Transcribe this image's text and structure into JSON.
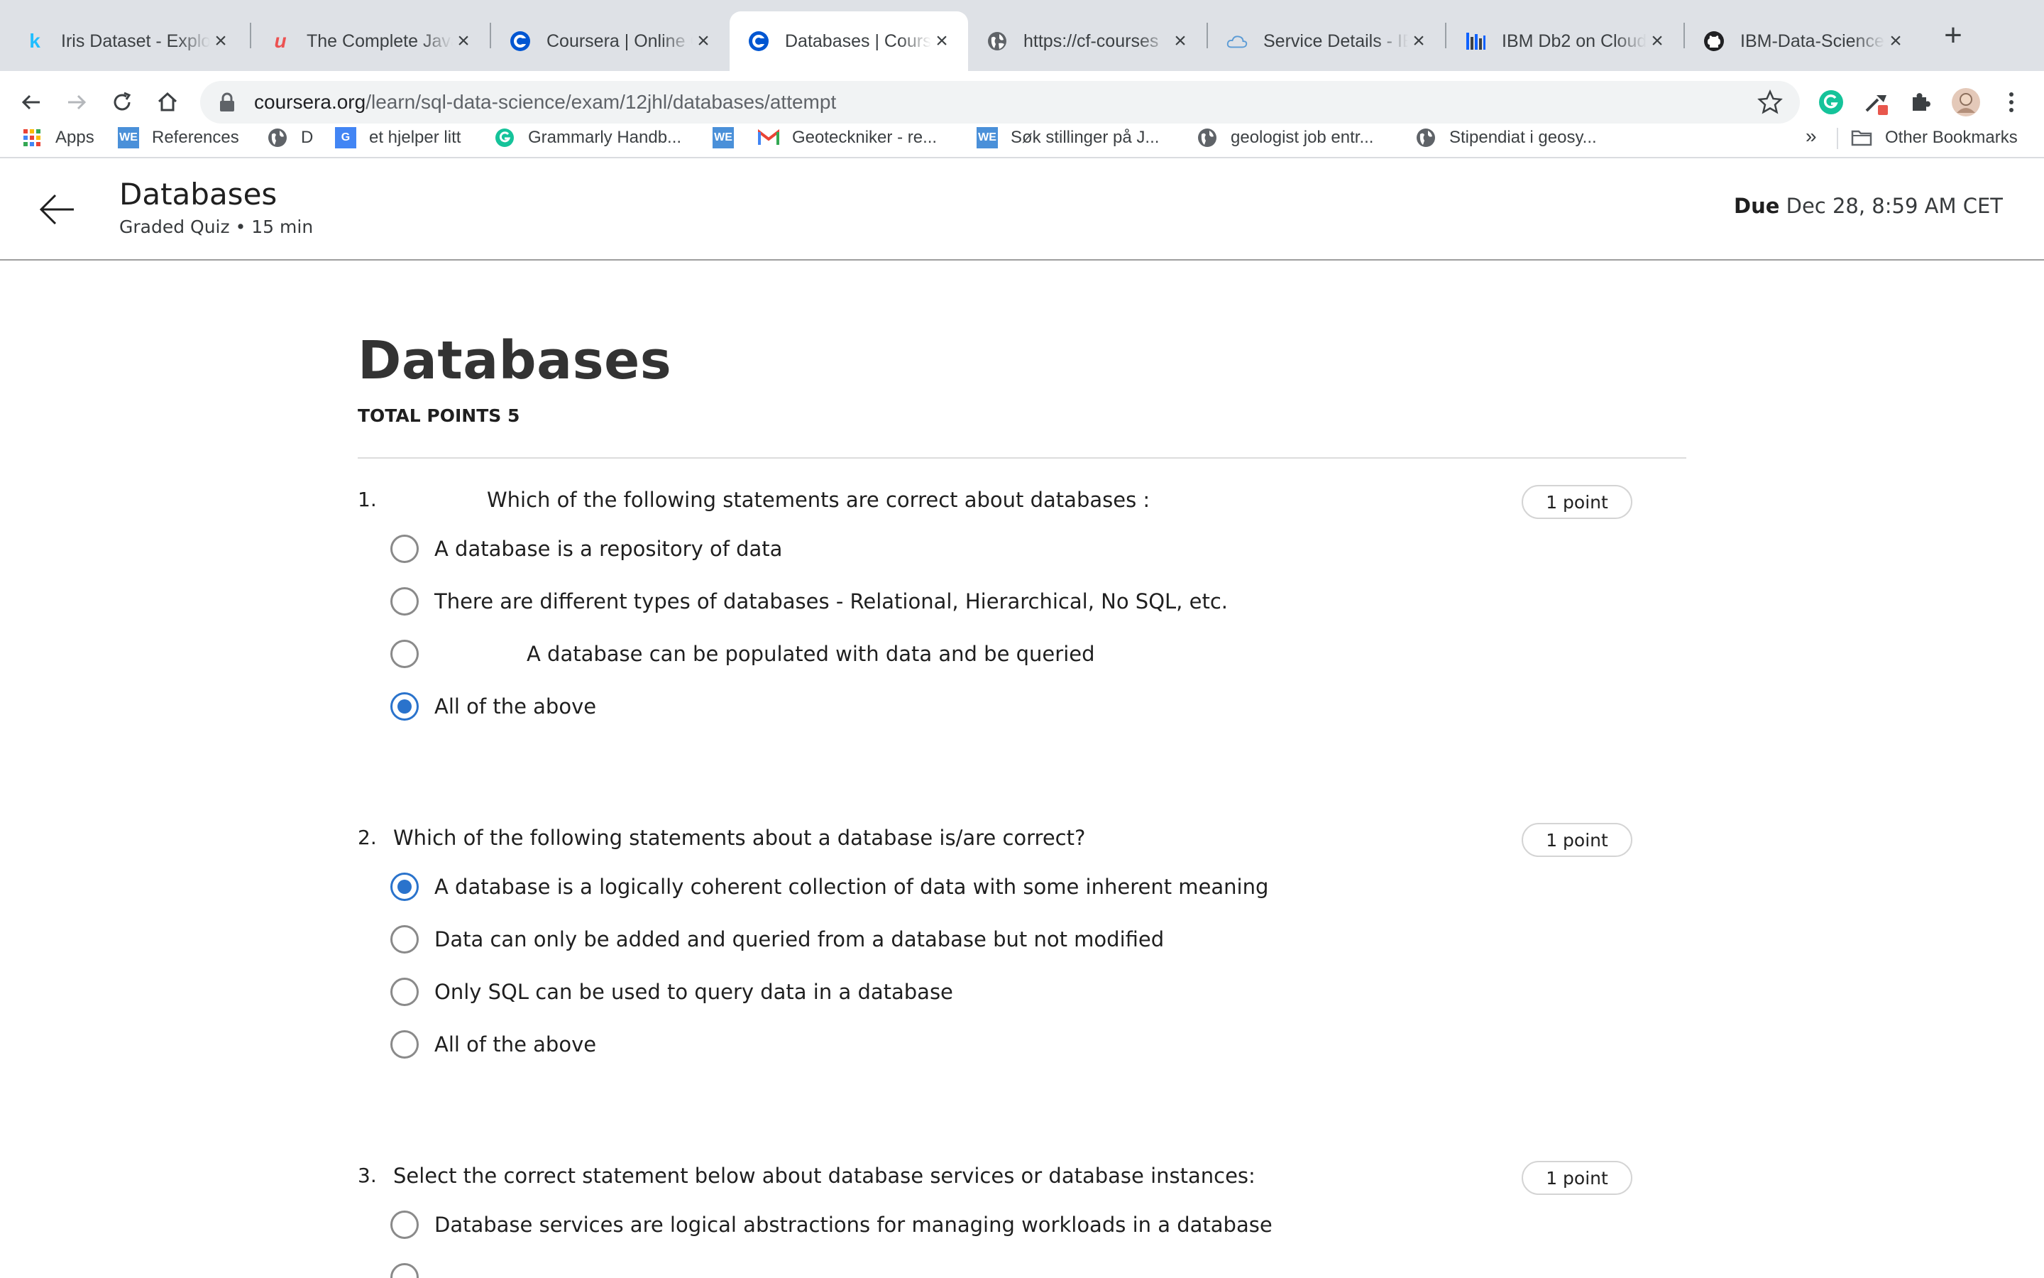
{
  "browser": {
    "tabs": [
      {
        "title": "Iris Dataset - Explo",
        "icon": "kaggle-k-icon"
      },
      {
        "title": "The Complete Java",
        "icon": "udemy-icon"
      },
      {
        "title": "Coursera | Online C",
        "icon": "coursera-icon"
      },
      {
        "title": "Databases | Cours",
        "icon": "coursera-icon",
        "active": true
      },
      {
        "title": "https://cf-courses",
        "icon": "globe-icon"
      },
      {
        "title": "Service Details - IB",
        "icon": "cloud-icon"
      },
      {
        "title": "IBM Db2 on Cloud",
        "icon": "ibm-db2-icon"
      },
      {
        "title": "IBM-Data-Science",
        "icon": "github-icon"
      }
    ],
    "url_host": "coursera.org",
    "url_path": "/learn/sql-data-science/exam/12jhl/databases/attempt",
    "bookmarks": [
      {
        "label": "Apps",
        "icon": "apps-grid-icon"
      },
      {
        "label": "References",
        "icon": "we-icon"
      },
      {
        "label": "D",
        "icon": "globe-icon"
      },
      {
        "label": "et hjelper litt",
        "icon": "translate-icon"
      },
      {
        "label": "Grammarly Handb...",
        "icon": "grammarly-icon"
      },
      {
        "label": "",
        "icon": "we-icon"
      },
      {
        "label": "Geoteckniker - re...",
        "icon": "gmail-icon"
      },
      {
        "label": "Søk stillinger på J...",
        "icon": "we-icon"
      },
      {
        "label": "geologist job entr...",
        "icon": "globe-icon"
      },
      {
        "label": "Stipendiat i geosy...",
        "icon": "globe-icon"
      }
    ],
    "more_bookmarks": "»",
    "other_bookmarks": "Other Bookmarks"
  },
  "header": {
    "title": "Databases",
    "subtitle": "Graded Quiz • 15 min",
    "due_label": "Due",
    "due_value": "Dec 28, 8:59 AM CET"
  },
  "quiz": {
    "title": "Databases",
    "total_points": "TOTAL POINTS 5",
    "questions": [
      {
        "number": "1.",
        "text": "Which of the following statements are correct about databases :",
        "points": "1 point",
        "options": [
          {
            "label": "A database is a repository of data",
            "selected": false
          },
          {
            "label": "There are different types of databases - Relational, Hierarchical, No SQL, etc.",
            "selected": false
          },
          {
            "label": "A database can be populated with data and be queried",
            "selected": false
          },
          {
            "label": "All of the above",
            "selected": true
          }
        ]
      },
      {
        "number": "2.",
        "text": "Which of the following statements about a database is/are correct?",
        "points": "1 point",
        "options": [
          {
            "label": "A database is a logically coherent collection of data with some inherent meaning",
            "selected": true
          },
          {
            "label": "Data can only be added and queried from a database but not modified",
            "selected": false
          },
          {
            "label": "Only SQL can be used to query data in a database",
            "selected": false
          },
          {
            "label": "All of the above",
            "selected": false
          }
        ]
      },
      {
        "number": "3.",
        "text": "Select the correct statement below about database services or database instances:",
        "points": "1 point",
        "options": [
          {
            "label": "Database services are logical abstractions for managing workloads in a database",
            "selected": false
          }
        ]
      }
    ]
  },
  "colors": {
    "accent": "#2a73cc",
    "tabstrip": "#dee1e6",
    "text": "#1f1f1f"
  }
}
